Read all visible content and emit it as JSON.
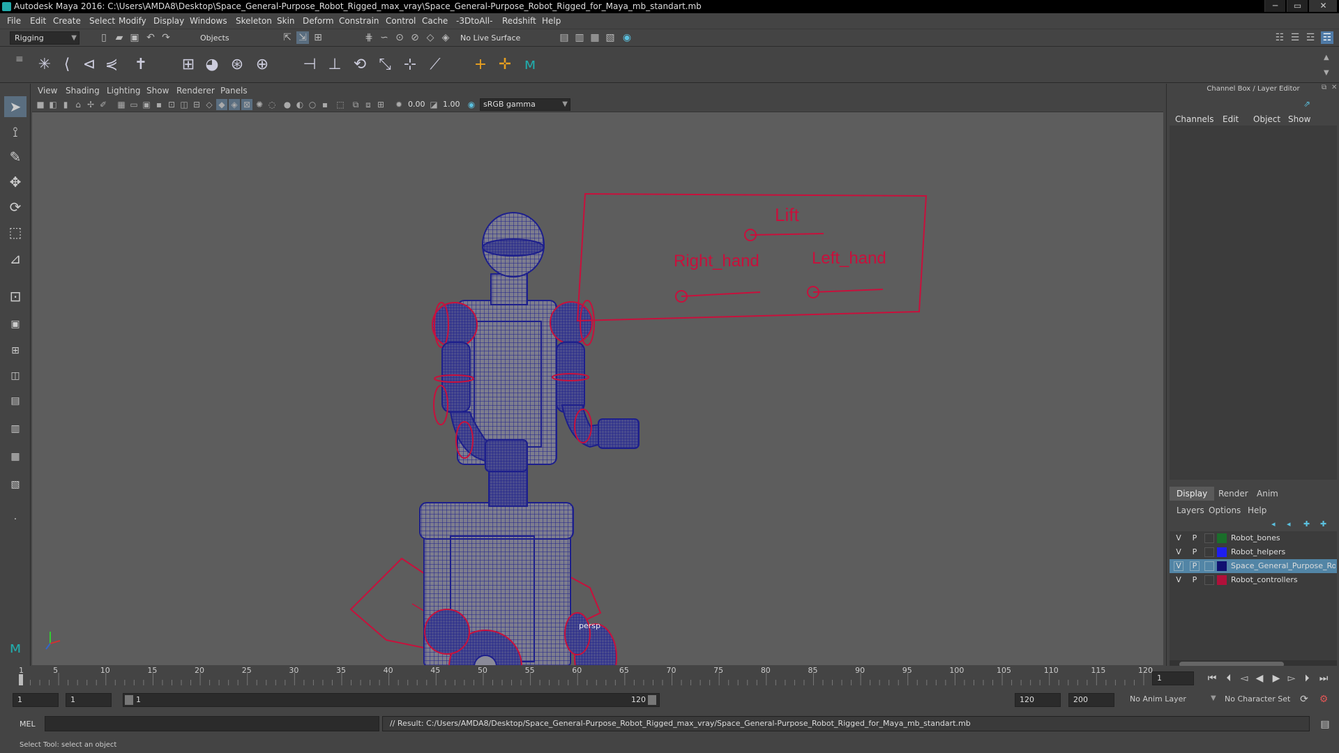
{
  "app": {
    "title": "Autodesk Maya 2016: C:\\Users\\AMDA8\\Desktop\\Space_General-Purpose_Robot_Rigged_max_vray\\Space_General-Purpose_Robot_Rigged_for_Maya_mb_standart.mb"
  },
  "menubar": {
    "items": [
      "File",
      "Edit",
      "Create",
      "Select",
      "Modify",
      "Display",
      "Windows",
      "Skeleton",
      "Skin",
      "Deform",
      "Constrain",
      "Control",
      "Cache",
      "-3DtoAll-",
      "Redshift",
      "Help"
    ]
  },
  "statusline": {
    "mode": "Rigging",
    "selection_mask": "Objects",
    "live_surface": "No Live Surface"
  },
  "viewport": {
    "menus": [
      "View",
      "Shading",
      "Lighting",
      "Show",
      "Renderer",
      "Panels"
    ],
    "exposure": "0.00",
    "gamma": "1.00",
    "color_space": "sRGB gamma",
    "camera_label": "persp",
    "controller_panel": {
      "lift": "Lift",
      "right_hand": "Right_hand",
      "left_hand": "Left_hand"
    },
    "colors": {
      "wire": "#1d1f8c",
      "controller": "#c8103c",
      "mesh": "#8c8c98"
    }
  },
  "channelbox": {
    "title": "Channel Box / Layer Editor",
    "menus": [
      "Channels",
      "Edit",
      "Object",
      "Show"
    ]
  },
  "layer_editor": {
    "tabs": [
      "Display",
      "Render",
      "Anim"
    ],
    "active_tab": "Display",
    "menus": [
      "Layers",
      "Options",
      "Help"
    ],
    "layers": [
      {
        "v": "V",
        "p": "P",
        "color": "#1a6e2a",
        "name": "Robot_bones",
        "selected": false
      },
      {
        "v": "V",
        "p": "P",
        "color": "#1e1ef0",
        "name": "Robot_helpers",
        "selected": false
      },
      {
        "v": "V",
        "p": "P",
        "color": "#101070",
        "name": "Space_General_Purpose_Robot",
        "selected": true
      },
      {
        "v": "V",
        "p": "P",
        "color": "#b0103a",
        "name": "Robot_controllers",
        "selected": false
      }
    ]
  },
  "timeline": {
    "ticks": [
      "1",
      "5",
      "10",
      "15",
      "20",
      "25",
      "30",
      "35",
      "40",
      "45",
      "50",
      "55",
      "60",
      "65",
      "70",
      "75",
      "80",
      "85",
      "90",
      "95",
      "100",
      "105",
      "110",
      "115",
      "120"
    ],
    "current_frame": "1"
  },
  "range": {
    "start": "1",
    "playback_start": "1",
    "slider_start": "1",
    "slider_end": "120",
    "playback_end": "120",
    "end": "200",
    "anim_layer": "No Anim Layer",
    "character_set": "No Character Set"
  },
  "cmdline": {
    "language": "MEL",
    "result": "// Result: C:/Users/AMDA8/Desktop/Space_General-Purpose_Robot_Rigged_max_vray/Space_General-Purpose_Robot_Rigged_for_Maya_mb_standart.mb"
  },
  "helpline": {
    "text": "Select Tool: select an object"
  }
}
